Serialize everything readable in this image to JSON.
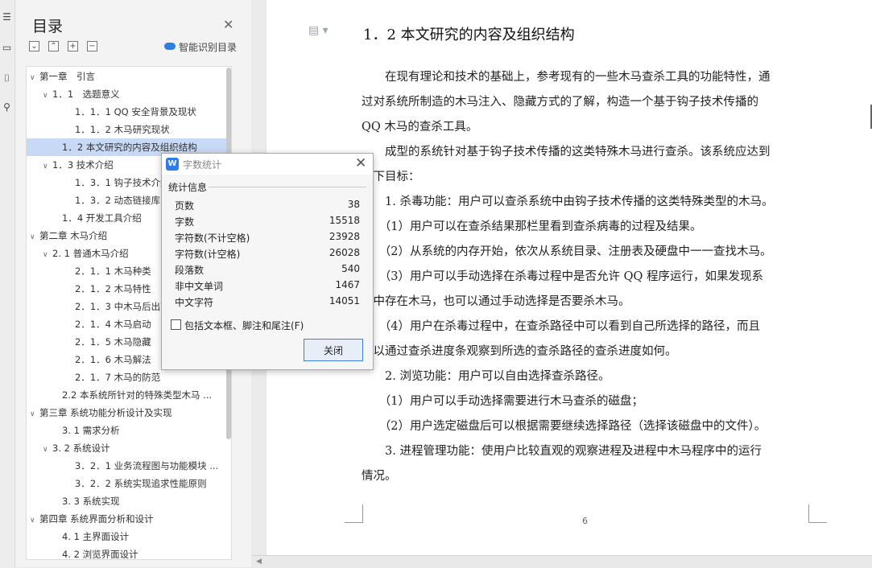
{
  "toc": {
    "title": "目录",
    "smart_label": "智能识别目录",
    "items": [
      {
        "label": "第一章　引言",
        "arrow": "∨",
        "indent": 0
      },
      {
        "label": "1．1　选题意义",
        "arrow": "∨",
        "indent": 1
      },
      {
        "label": "1．1．1 QQ 安全背景及现状",
        "arrow": "",
        "indent": 2
      },
      {
        "label": "1．1．2 木马研究现状",
        "arrow": "",
        "indent": 2
      },
      {
        "label": "1．2 本文研究的内容及组织结构",
        "arrow": "",
        "indent": 1
      },
      {
        "label": "1．3 技术介绍",
        "arrow": "∨",
        "indent": 1
      },
      {
        "label": "1．3．1 钩子技术介绍",
        "arrow": "",
        "indent": 2
      },
      {
        "label": "1．3．2 动态链接库",
        "arrow": "",
        "indent": 2
      },
      {
        "label": "1．4 开发工具介绍",
        "arrow": "",
        "indent": 1
      },
      {
        "label": "第二章 木马介绍",
        "arrow": "∨",
        "indent": 0
      },
      {
        "label": "2. 1 普通木马介绍",
        "arrow": "∨",
        "indent": 1
      },
      {
        "label": "2．1．1 木马种类",
        "arrow": "",
        "indent": 2
      },
      {
        "label": "2．1．2 木马特性",
        "arrow": "",
        "indent": 2
      },
      {
        "label": "2．1．3 中木马后出现的症状",
        "arrow": "",
        "indent": 2
      },
      {
        "label": "2．1．4 木马启动",
        "arrow": "",
        "indent": 2
      },
      {
        "label": "2．1．5 木马隐藏",
        "arrow": "",
        "indent": 2
      },
      {
        "label": "2．1．6 木马解法",
        "arrow": "",
        "indent": 2
      },
      {
        "label": "2．1．7 木马的防范",
        "arrow": "",
        "indent": 2
      },
      {
        "label": "2.2 本系统所针对的特殊类型木马 ...",
        "arrow": "",
        "indent": 1
      },
      {
        "label": "第三章 系统功能分析设计及实现",
        "arrow": "∨",
        "indent": 0
      },
      {
        "label": "3. 1 需求分析",
        "arrow": "",
        "indent": 1
      },
      {
        "label": "3. 2 系统设计",
        "arrow": "∨",
        "indent": 1
      },
      {
        "label": "3．2．1 业务流程图与功能模块 ...",
        "arrow": "",
        "indent": 2
      },
      {
        "label": "3．2．2 系统实现追求性能原则",
        "arrow": "",
        "indent": 2
      },
      {
        "label": "3. 3 系统实现",
        "arrow": "",
        "indent": 1
      },
      {
        "label": "第四章 系统界面分析和设计",
        "arrow": "∨",
        "indent": 0
      },
      {
        "label": "4. 1 主界面设计",
        "arrow": "",
        "indent": 1
      },
      {
        "label": "4. 2 浏览界面设计",
        "arrow": "",
        "indent": 1
      }
    ]
  },
  "document": {
    "heading": "1．2 本文研究的内容及组织结构",
    "paragraphs": [
      "　　在现有理论和技术的基础上，参考现有的一些木马查杀工具的功能特性，通",
      "过对系统所制造的木马注入、隐藏方式的了解，构造一个基于钩子技术传播的",
      "QQ 木马的查杀工具。",
      "　　成型的系统针对基于钩子技术传播的这类特殊木马进行查杀。该系统应达到",
      "如下目标：",
      "　　1. 杀毒功能：用户可以查杀系统中由钩子技术传播的这类特殊类型的木马。",
      "　　（1）用户可以在查杀结果那栏里看到查杀病毒的过程及结果。",
      "　　（2）从系统的内存开始，依次从系统目录、注册表及硬盘中一一查找木马。",
      "　　（3）用户可以手动选择在杀毒过程中是否允许 QQ 程序运行，如果发现系",
      "统中存在木马，也可以通过手动选择是否要杀木马。",
      "　　（4）用户在杀毒过程中，在查杀路径中可以看到自己所选择的路径，而且",
      "可以通过查杀进度条观察到所选的查杀路径的查杀进度如何。",
      "　　2. 浏览功能：用户可以自由选择查杀路径。",
      "　　（1）用户可以手动选择需要进行木马查杀的磁盘；",
      "　　（2）用户选定磁盘后可以根据需要继续选择路径（选择该磁盘中的文件）。",
      "　　3. 进程管理功能：使用户比较直观的观察进程及进程中木马程序中的运行",
      "情况。"
    ],
    "page_number": "6"
  },
  "dialog": {
    "title": "字数统计",
    "section": "统计信息",
    "stats": [
      {
        "label": "页数",
        "value": "38"
      },
      {
        "label": "字数",
        "value": "15518"
      },
      {
        "label": "字符数(不计空格)",
        "value": "23928"
      },
      {
        "label": "字符数(计空格)",
        "value": "26028"
      },
      {
        "label": "段落数",
        "value": "540"
      },
      {
        "label": "非中文单词",
        "value": "1467"
      },
      {
        "label": "中文字符",
        "value": "14051"
      }
    ],
    "checkbox_label": "包括文本框、脚注和尾注(F)",
    "close_button": "关闭"
  }
}
